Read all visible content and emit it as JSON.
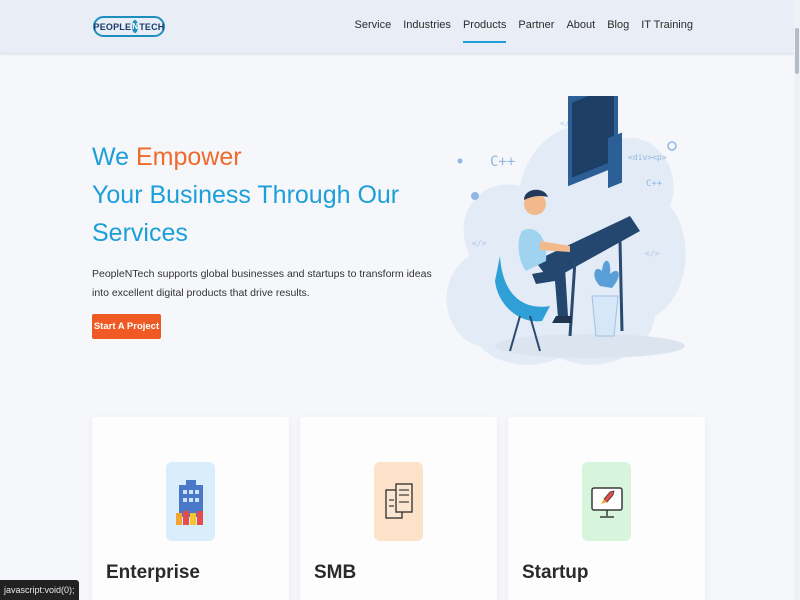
{
  "header": {
    "logo_left": "PEOPLE",
    "logo_n": "N",
    "logo_right": "TECH",
    "nav": [
      "Service",
      "Industries",
      "Products",
      "Partner",
      "About",
      "Blog",
      "IT Training"
    ],
    "active_nav": "Products"
  },
  "hero": {
    "title_line1_a": "We ",
    "title_line1_b": "Empower",
    "title_line2": "Your Business Through Our",
    "title_line3": "Services",
    "description": "PeopleNTech supports global businesses and startups to transform ideas into excellent digital products that drive results.",
    "cta_label": "Start A Project",
    "illustration_glyphs": {
      "cpp1": "C++",
      "cpp2": "C++",
      "divp": "<div><p>",
      "tag1": "</>",
      "tag2": "</>",
      "tag3": "</>"
    }
  },
  "cards": [
    {
      "title": "Enterprise",
      "icon": "building-icon",
      "bg": "#d9eefa"
    },
    {
      "title": "SMB",
      "icon": "server-icon",
      "bg": "#fde1c8"
    },
    {
      "title": "Startup",
      "icon": "rocket-monitor-icon",
      "bg": "#d6f5dc"
    }
  ],
  "status_bar": "javascript:void(0);",
  "colors": {
    "primary": "#1c9fd8",
    "accent": "#ef6a2c",
    "cta": "#ef5a24"
  }
}
